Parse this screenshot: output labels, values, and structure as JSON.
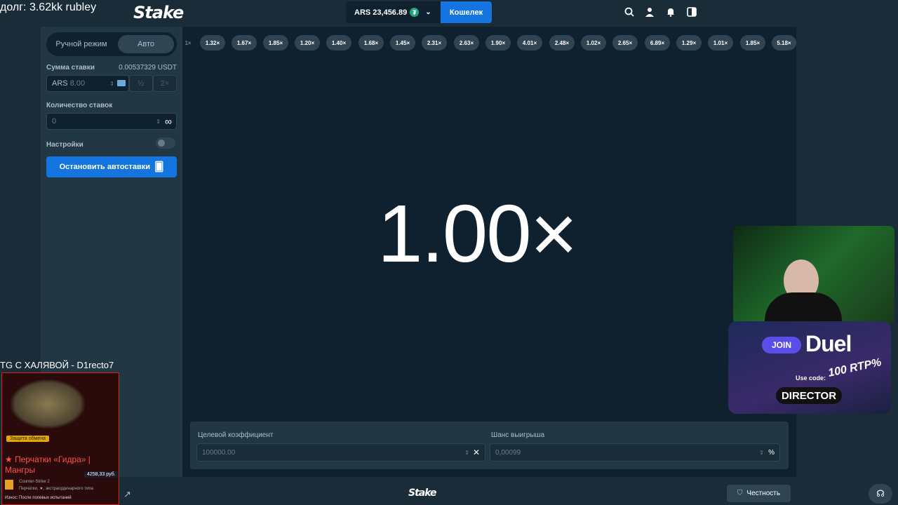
{
  "stream": {
    "debt_caption": "долг: 3.62kk rubley",
    "tg_caption": "TG С ХАЛЯВОЙ - D1recto7"
  },
  "header": {
    "logo": "Stake",
    "balance": "ARS 23,456.89",
    "currency_icon": "tether-icon",
    "wallet_label": "Кошелек"
  },
  "sidebar": {
    "mode_manual": "Ручной режим",
    "mode_auto": "Авто",
    "bet_amount_label": "Сумма ставки",
    "bet_amount_usdt": "0.00537329 USDT",
    "bet_currency": "ARS",
    "bet_value": "8.00",
    "half_label": "½",
    "double_label": "2×",
    "bet_count_label": "Количество ставок",
    "bet_count_value": "0",
    "settings_label": "Настройки",
    "stop_button": "Остановить автоставки"
  },
  "history": [
    "1×",
    "1.32×",
    "1.67×",
    "1.85×",
    "1.20×",
    "1.40×",
    "1.68×",
    "1.45×",
    "2.31×",
    "2.63×",
    "1.90×",
    "4.01×",
    "2.48×",
    "1.02×",
    "2.65×",
    "6.89×",
    "1.29×",
    "1.01×",
    "1.85×",
    "5.18×"
  ],
  "game": {
    "multiplier": "1.00×"
  },
  "bottom_panel": {
    "target_label": "Целевой коэффициент",
    "target_value": "100000.00",
    "chance_label": "Шанс выигрыша",
    "chance_value": "0,00099"
  },
  "footer": {
    "logo": "Stake",
    "fairness_label": "Честность"
  },
  "skin_card": {
    "badge": "Защита обмена",
    "title": "★ Перчатки «Гидра» | Мангры",
    "price": "4258,33 руб.",
    "game": "Counter-Strike 2",
    "desc": "Перчатки, ★, экстраординарного типа",
    "wear": "Износ: После полевых испытаний"
  },
  "duel_promo": {
    "join": "JOIN",
    "brand": "Duel",
    "rtp": "100 RTP%",
    "use_code": "Use code:",
    "code": "DIRECTOR"
  },
  "colors": {
    "accent_blue": "#1475e1",
    "panel_dark": "#0f212e",
    "sidebar_bg": "#213743",
    "pill_bg": "#2f4553"
  }
}
